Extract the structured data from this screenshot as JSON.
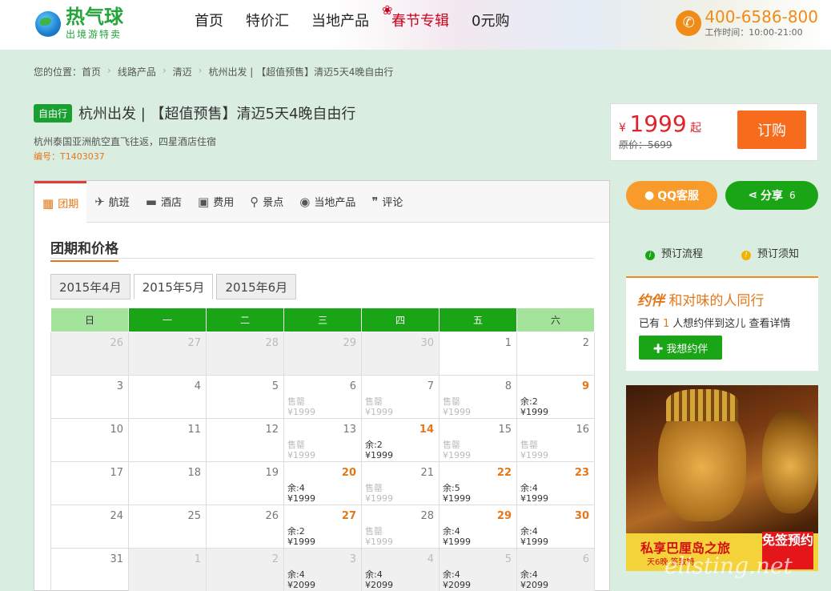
{
  "header": {
    "logo_name": "热气球",
    "logo_sub": "出境游特卖",
    "nav": [
      "首页",
      "特价汇",
      "当地产品",
      "春节专辑",
      "0元购"
    ],
    "phone": "400-6586-800",
    "hours": "工作时间：10:00-21:00"
  },
  "breadcrumb": [
    "您的位置：首页",
    "线路产品",
    "清迈",
    "杭州出发 | 【超值预售】清迈5天4晚自由行"
  ],
  "product": {
    "badge": "自由行",
    "title": "杭州出发 | 【超值预售】清迈5天4晚自由行",
    "subtitle": "杭州泰国亚洲航空直飞往返，四星酒店住宿",
    "code": "编号：T1403037",
    "price_symbol": "¥",
    "price": "1999",
    "price_suffix": "起",
    "original_price": "原价：5699",
    "book_label": "订购"
  },
  "tabs": [
    {
      "label": "团期",
      "icon": "calendar-icon"
    },
    {
      "label": "航班",
      "icon": "plane-icon"
    },
    {
      "label": "酒店",
      "icon": "bed-icon"
    },
    {
      "label": "费用",
      "icon": "wallet-icon"
    },
    {
      "label": "景点",
      "icon": "pin-icon"
    },
    {
      "label": "当地产品",
      "icon": "location-icon"
    },
    {
      "label": "评论",
      "icon": "quote-icon"
    }
  ],
  "section_title": "团期和价格",
  "months": [
    "2015年4月",
    "2015年5月",
    "2015年6月"
  ],
  "weekdays": [
    "日",
    "一",
    "二",
    "三",
    "四",
    "五",
    "六"
  ],
  "calendar": [
    [
      {
        "d": "26",
        "g": true
      },
      {
        "d": "27",
        "g": true
      },
      {
        "d": "28",
        "g": true
      },
      {
        "d": "29",
        "g": true
      },
      {
        "d": "30",
        "g": true
      },
      {
        "d": "1"
      },
      {
        "d": "2"
      }
    ],
    [
      {
        "d": "3"
      },
      {
        "d": "4"
      },
      {
        "d": "5"
      },
      {
        "d": "6",
        "s": "售罄",
        "p": "¥1999",
        "so": true
      },
      {
        "d": "7",
        "s": "售罄",
        "p": "¥1999",
        "so": true
      },
      {
        "d": "8",
        "s": "售罄",
        "p": "¥1999",
        "so": true
      },
      {
        "d": "9",
        "s": "余:2",
        "p": "¥1999",
        "hot": true
      }
    ],
    [
      {
        "d": "10"
      },
      {
        "d": "11"
      },
      {
        "d": "12"
      },
      {
        "d": "13",
        "s": "售罄",
        "p": "¥1999",
        "so": true
      },
      {
        "d": "14",
        "s": "余:2",
        "p": "¥1999",
        "hot": true
      },
      {
        "d": "15",
        "s": "售罄",
        "p": "¥1999",
        "so": true
      },
      {
        "d": "16",
        "s": "售罄",
        "p": "¥1999",
        "so": true
      }
    ],
    [
      {
        "d": "17"
      },
      {
        "d": "18"
      },
      {
        "d": "19"
      },
      {
        "d": "20",
        "s": "余:4",
        "p": "¥1999",
        "hot": true
      },
      {
        "d": "21",
        "s": "售罄",
        "p": "¥1999",
        "so": true
      },
      {
        "d": "22",
        "s": "余:5",
        "p": "¥1999",
        "hot": true
      },
      {
        "d": "23",
        "s": "余:4",
        "p": "¥1999",
        "hot": true
      }
    ],
    [
      {
        "d": "24"
      },
      {
        "d": "25"
      },
      {
        "d": "26"
      },
      {
        "d": "27",
        "s": "余:2",
        "p": "¥1999",
        "hot": true
      },
      {
        "d": "28",
        "s": "售罄",
        "p": "¥1999",
        "so": true
      },
      {
        "d": "29",
        "s": "余:4",
        "p": "¥1999",
        "hot": true
      },
      {
        "d": "30",
        "s": "余:4",
        "p": "¥1999",
        "hot": true
      }
    ],
    [
      {
        "d": "31"
      },
      {
        "d": "1",
        "g": true
      },
      {
        "d": "2",
        "g": true
      },
      {
        "d": "3",
        "g": true,
        "s": "余:4",
        "p": "¥2099"
      },
      {
        "d": "4",
        "g": true,
        "s": "余:4",
        "p": "¥2099"
      },
      {
        "d": "5",
        "g": true,
        "s": "余:4",
        "p": "¥2099"
      },
      {
        "d": "6",
        "g": true,
        "s": "余:4",
        "p": "¥2099"
      }
    ]
  ],
  "sidebar": {
    "qq_label": "QQ客服",
    "share_label": "分享",
    "share_count": "6",
    "flow_label": "预订流程",
    "notice_label": "预订须知",
    "partner_title_b": "约伴",
    "partner_title": "和对味的人同行",
    "partner_pre": "已有",
    "partner_count": "1",
    "partner_post": "人想约伴到这儿",
    "partner_link": "查看详情",
    "partner_btn": "我想约伴",
    "ad_title": "私享巴厘岛之旅",
    "ad_sub": "天6晚 签致特",
    "ad_badge": "免签预约"
  },
  "watermark": "elisting.net",
  "colors": {
    "green": "#1aa517",
    "orange": "#e47718",
    "red": "#e0232b"
  }
}
